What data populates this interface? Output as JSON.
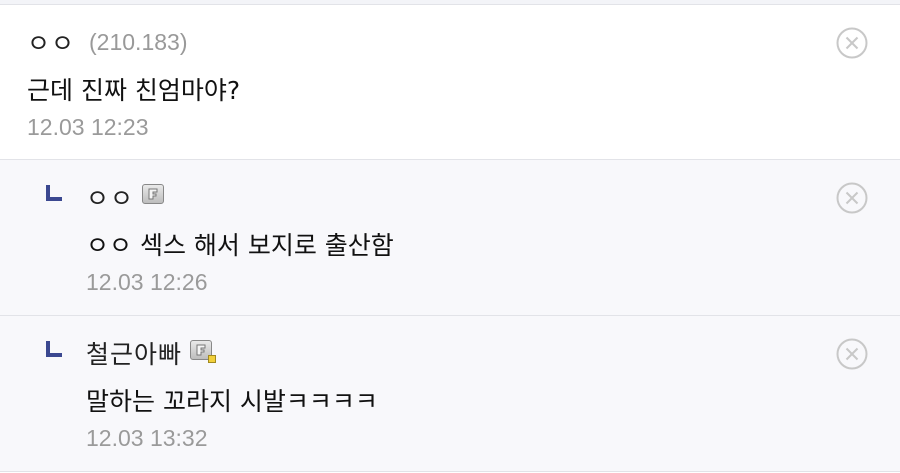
{
  "comments": [
    {
      "nickname": "ㅇㅇ",
      "ip": "(210.183)",
      "text": "근데 진짜 친엄마야?",
      "date": "12.03 12:23",
      "is_reply": false
    },
    {
      "nickname": "ㅇㅇ",
      "text": "ㅇㅇ 섹스 해서 보지로 출산함",
      "date": "12.03 12:26",
      "is_reply": true,
      "badge_icon": "gallog-icon"
    },
    {
      "nickname": "철근아빠",
      "text": "말하는 꼬라지 시발ㅋㅋㅋㅋ",
      "date": "12.03 13:32",
      "is_reply": true,
      "badge_icon": "gallog-icon-fixed"
    }
  ],
  "icons": {
    "delete": "circle-x-icon",
    "reply": "reply-arrow-icon"
  },
  "colors": {
    "reply_mark": "#3b4890",
    "meta_text": "#9a9a9a",
    "reply_background": "#f8f8fb"
  }
}
